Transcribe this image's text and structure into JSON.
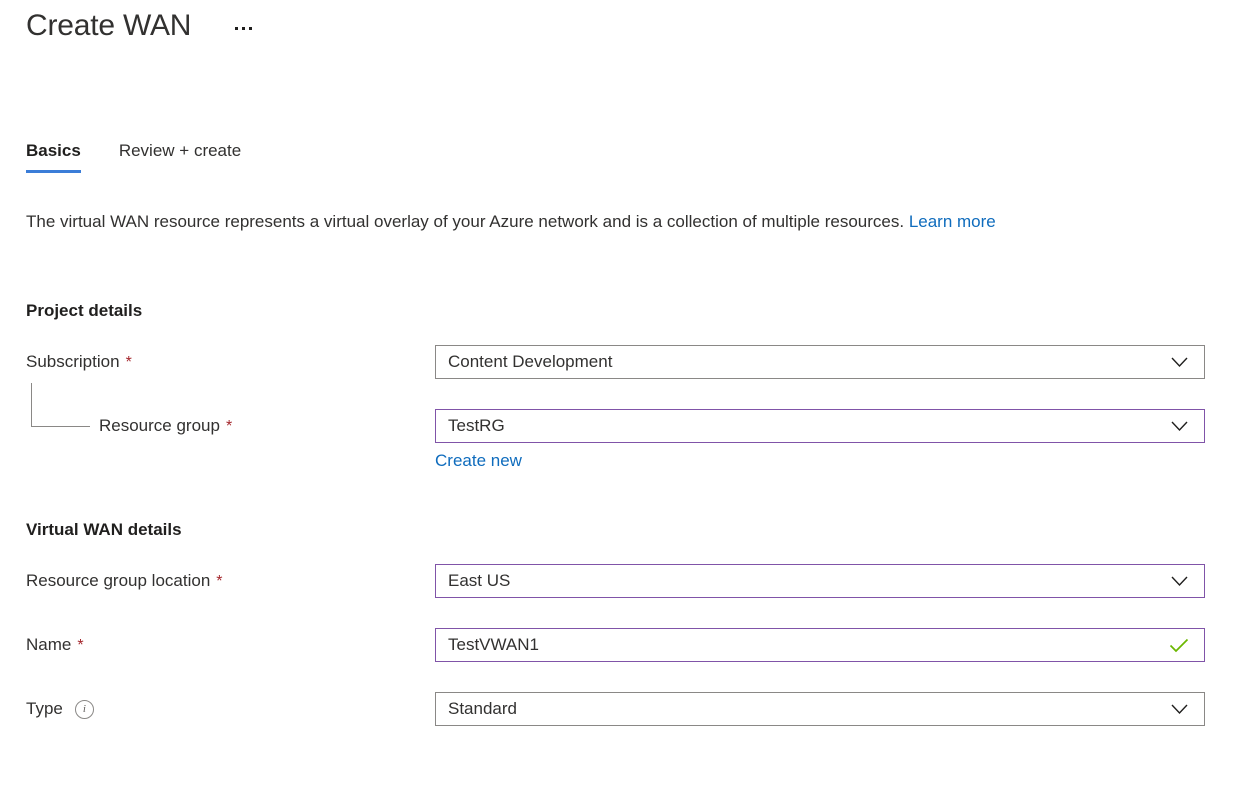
{
  "header": {
    "title": "Create WAN",
    "more_menu_label": "…"
  },
  "tabs": [
    {
      "label": "Basics",
      "active": true
    },
    {
      "label": "Review + create",
      "active": false
    }
  ],
  "description": {
    "text": "The virtual WAN resource represents a virtual overlay of your Azure network and is a collection of multiple resources. ",
    "link_label": "Learn more"
  },
  "sections": {
    "project_details": {
      "heading": "Project details",
      "fields": {
        "subscription": {
          "label": "Subscription",
          "required_marker": "*",
          "value": "Content Development",
          "control": "dropdown",
          "focused": false
        },
        "resource_group": {
          "label": "Resource group",
          "required_marker": "*",
          "value": "TestRG",
          "control": "dropdown",
          "focused": true,
          "action_link": "Create new"
        }
      }
    },
    "virtual_wan_details": {
      "heading": "Virtual WAN details",
      "fields": {
        "resource_group_location": {
          "label": "Resource group location",
          "required_marker": "*",
          "value": "East US",
          "control": "dropdown",
          "focused": true
        },
        "name": {
          "label": "Name",
          "required_marker": "*",
          "value": "TestVWAN1",
          "control": "textbox",
          "focused": true,
          "validation": "valid"
        },
        "type": {
          "label": "Type",
          "required_marker": "",
          "info_glyph": "i",
          "value": "Standard",
          "control": "dropdown",
          "focused": false
        }
      }
    }
  },
  "colors": {
    "accent_blue": "#3b7dd8",
    "link_blue": "#0f6cbd",
    "required_red": "#a4262c",
    "focus_purple": "#8054a8",
    "valid_green": "#6bb700",
    "border_gray": "#8a8886",
    "text": "#323130"
  }
}
